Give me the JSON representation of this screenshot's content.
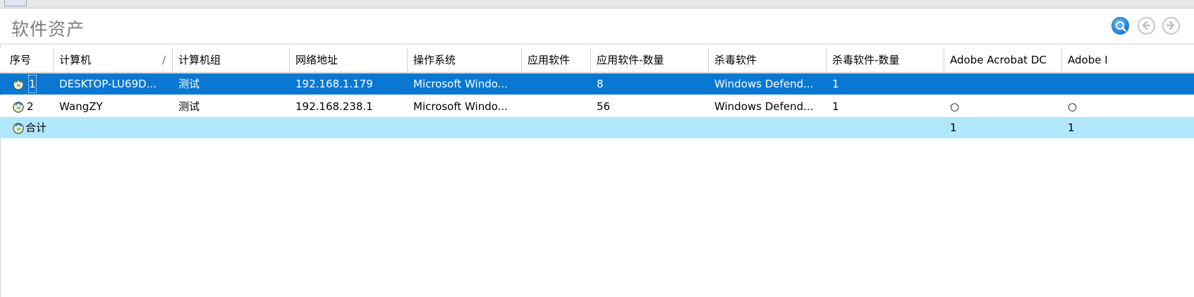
{
  "window": {
    "title": "软件资产"
  },
  "toolbar": {
    "search_icon": "search-icon",
    "back_icon": "back-arrow-icon",
    "forward_icon": "forward-arrow-icon"
  },
  "columns": [
    "序号",
    "计算机",
    "计算机组",
    "网络地址",
    "操作系统",
    "应用软件",
    "应用软件-数量",
    "杀毒软件",
    "杀毒软件-数量",
    "Adobe Acrobat DC",
    "Adobe I"
  ],
  "sort_indicator": "/",
  "rows": [
    {
      "seq": "1",
      "computer": "DESKTOP-LU69D...",
      "group": "测试",
      "ip": "192.168.1.179",
      "os": "Microsoft Windo...",
      "apps": "",
      "apps_count": "8",
      "antivirus": "Windows Defend...",
      "antivirus_count": "1",
      "adobe_acrobat_dc": "",
      "adobe_i": "",
      "selected": true
    },
    {
      "seq": "2",
      "computer": "WangZY",
      "group": "测试",
      "ip": "192.168.238.1",
      "os": "Microsoft Windo...",
      "apps": "",
      "apps_count": "56",
      "antivirus": "Windows Defend...",
      "antivirus_count": "1",
      "adobe_acrobat_dc": "○",
      "adobe_i": "○",
      "selected": false
    }
  ],
  "total": {
    "label": "合计",
    "adobe_acrobat_dc": "1",
    "adobe_i": "1"
  },
  "colors": {
    "selection": "#0a78d2",
    "total_row": "#b2e6fb",
    "title": "#7f7f7f"
  }
}
